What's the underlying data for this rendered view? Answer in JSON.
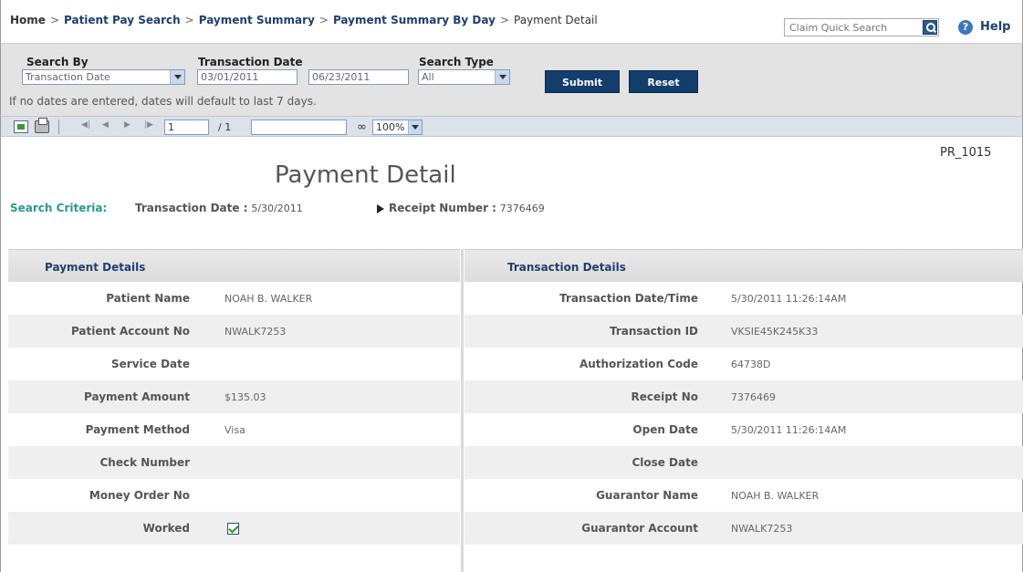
{
  "breadcrumb": {
    "home": "Home",
    "sep": ">",
    "items": [
      "Patient Pay Search",
      "Payment Summary",
      "Payment Summary By Day"
    ],
    "current": "Payment Detail"
  },
  "quick_search": {
    "placeholder": "Claim Quick Search"
  },
  "help": {
    "label": "Help"
  },
  "search": {
    "search_by_label": "Search By",
    "search_by_value": "Transaction Date",
    "transaction_date_label": "Transaction Date",
    "date_from": "03/01/2011",
    "date_to": "06/23/2011",
    "search_type_label": "Search Type",
    "search_type_value": "All",
    "submit_label": "Submit",
    "reset_label": "Reset",
    "note": "If no dates are entered, dates will default to last 7 days."
  },
  "toolbar": {
    "page_value": "1",
    "page_of": "/ 1",
    "zoom_value": "100%"
  },
  "report": {
    "id": "PR_1015",
    "title": "Payment Detail",
    "criteria_label": "Search Criteria:",
    "criteria": [
      {
        "key": "Transaction Date :",
        "value": "5/30/2011"
      },
      {
        "key": "Receipt Number :",
        "value": "7376469"
      }
    ]
  },
  "payment_details": {
    "heading": "Payment Details",
    "rows": [
      {
        "label": "Patient Name",
        "value": "NOAH B. WALKER"
      },
      {
        "label": "Patient Account No",
        "value": "NWALK7253"
      },
      {
        "label": "Service Date",
        "value": ""
      },
      {
        "label": "Payment Amount",
        "value": "$135.03"
      },
      {
        "label": "Payment Method",
        "value": "Visa"
      },
      {
        "label": "Check Number",
        "value": ""
      },
      {
        "label": "Money Order No",
        "value": ""
      },
      {
        "label": "Worked",
        "value": "",
        "checked": true
      }
    ]
  },
  "transaction_details": {
    "heading": "Transaction Details",
    "rows": [
      {
        "label": "Transaction Date/Time",
        "value": "5/30/2011 11:26:14AM"
      },
      {
        "label": "Transaction ID",
        "value": "VKSIE45K245K33"
      },
      {
        "label": "Authorization Code",
        "value": "64738D"
      },
      {
        "label": "Receipt No",
        "value": "7376469"
      },
      {
        "label": "Open Date",
        "value": "5/30/2011 11:26:14AM"
      },
      {
        "label": "Close Date",
        "value": ""
      },
      {
        "label": "Guarantor Name",
        "value": "NOAH B. WALKER"
      },
      {
        "label": "Guarantor Account",
        "value": "NWALK7253"
      }
    ]
  }
}
